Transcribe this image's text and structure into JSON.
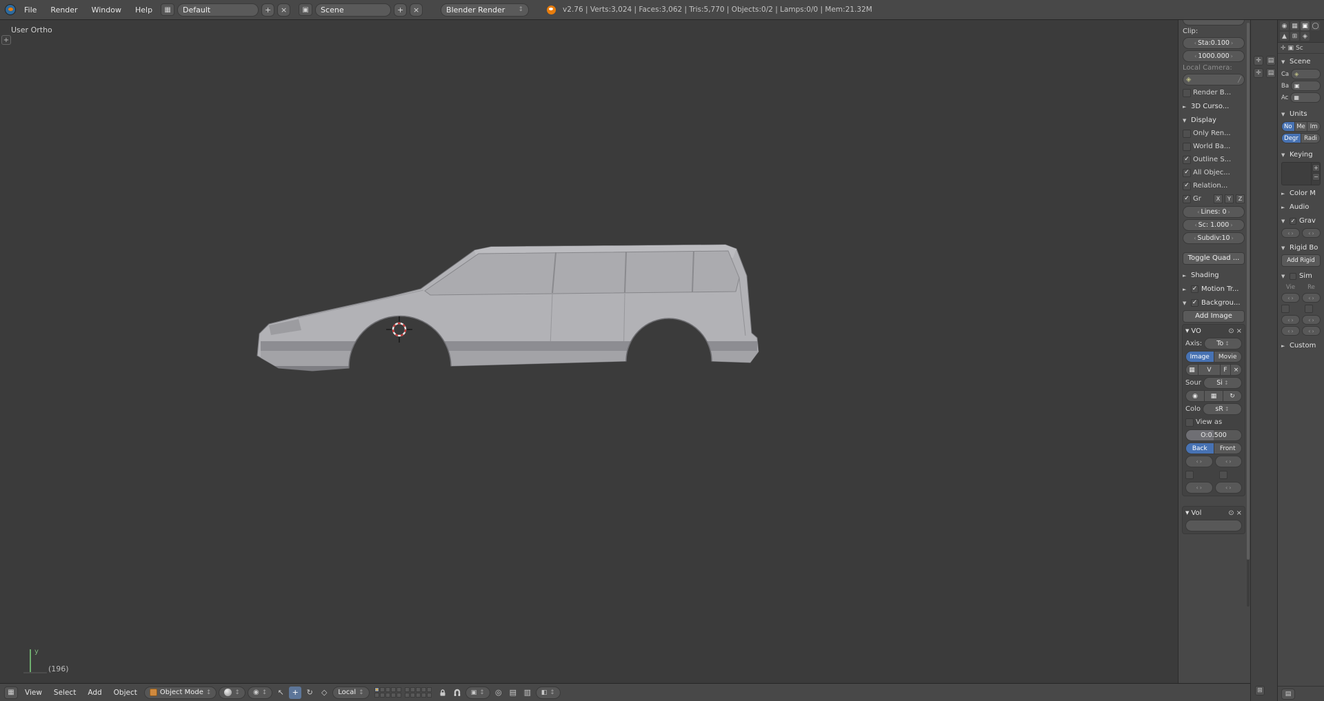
{
  "colors": {
    "accent_blue": "#4772b3",
    "viewport_bg": "#3b3b3b",
    "panel_bg": "#484848",
    "car_body": "#b3b3b7"
  },
  "header": {
    "menus": [
      "File",
      "Render",
      "Window",
      "Help"
    ],
    "layout_value": "Default",
    "scene_value": "Scene",
    "engine_value": "Blender Render",
    "stats": "v2.76 | Verts:3,024 | Faces:3,062 | Tris:5,770 | Objects:0/2 | Lamps:0/0 | Mem:21.32M"
  },
  "viewport": {
    "view_name": "User Ortho",
    "frame_label": "(196)",
    "axis_label": "y"
  },
  "npanel": {
    "clip_label": "Clip:",
    "clip_start": "Sta:0.100",
    "clip_end": "1000.000",
    "local_camera_label": "Local Camera:",
    "render_border_label": "Render B...",
    "cursor_header": "3D Curso...",
    "display_header": "Display",
    "only_render_label": "Only Ren...",
    "world_bg_label": "World Ba...",
    "outline_label": "Outline S...",
    "all_origins_label": "All Objec...",
    "relationship_label": "Relation...",
    "grid_label": "Gr",
    "grid_x": "X",
    "grid_y": "Y",
    "grid_z": "Z",
    "lines_value": "Lines: 0",
    "scale_value": "Sc: 1.000",
    "subdiv_value": "Subdiv:10",
    "toggle_quad_label": "Toggle Quad ...",
    "shading_header": "Shading",
    "motion_header": "Motion Tr...",
    "background_header": "Backgrou...",
    "add_image_label": "Add Image",
    "image1_name": "VO",
    "axis_label": "Axis:",
    "axis_value": "To",
    "image_label": "Image",
    "movie_label": "Movie",
    "datablock_value": "V",
    "fake_user_label": "F",
    "source_label": "Sour",
    "source_value": "Si",
    "colorspace_label": "Colo",
    "colorspace_value": "sR",
    "view_as_label": "View as",
    "opacity_value": "O:0.500",
    "back_label": "Back",
    "front_label": "Front",
    "image2_name": "Vol"
  },
  "properties": {
    "breadcrumb": "Sc",
    "scene_header": "Scene",
    "camera_label": "Ca",
    "background_label": "Ba",
    "clip_label": "Ac",
    "units_header": "Units",
    "unit_none": "No",
    "unit_metric": "Me",
    "unit_imperial": "Im",
    "rot_degrees": "Degr",
    "rot_radians": "Radi",
    "keying_header": "Keying",
    "colorm_header": "Color M",
    "audio_header": "Audio",
    "gravity_header": "Grav",
    "rigid_header": "Rigid Bo",
    "add_rigid_label": "Add Rigid",
    "simplify_header": "Sim",
    "col_viewport": "Vie",
    "col_render": "Re",
    "custom_header": "Custom"
  },
  "toolbar": {
    "menus": [
      "View",
      "Select",
      "Add",
      "Object"
    ],
    "mode_value": "Object Mode",
    "orientation_value": "Local"
  }
}
